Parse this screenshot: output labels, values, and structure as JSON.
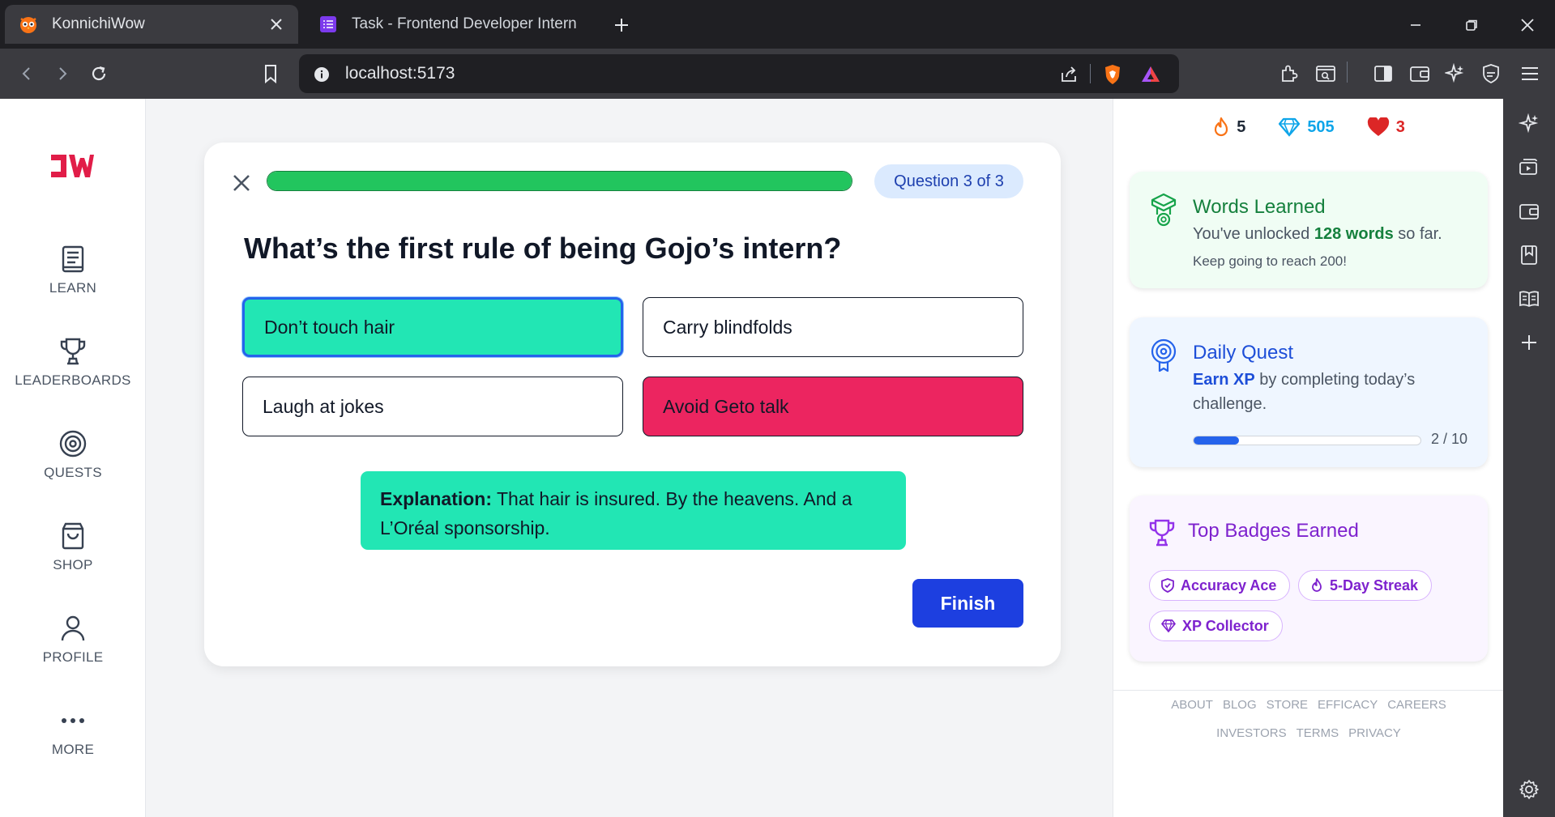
{
  "browser": {
    "tabs": [
      {
        "title": "KonnichiWow",
        "active": true
      },
      {
        "title": "Task - Frontend Developer Intern",
        "active": false
      }
    ],
    "url": "localhost:5173"
  },
  "nav": {
    "logo": "JW",
    "items": [
      {
        "label": "LEARN",
        "icon": "book-icon"
      },
      {
        "label": "LEADERBOARDS",
        "icon": "trophy-icon"
      },
      {
        "label": "QUESTS",
        "icon": "target-icon"
      },
      {
        "label": "SHOP",
        "icon": "shopping-bag-icon"
      },
      {
        "label": "PROFILE",
        "icon": "user-icon"
      },
      {
        "label": "MORE",
        "icon": "more-dots-icon"
      }
    ]
  },
  "quiz": {
    "progress": 1.0,
    "counter": "Question 3 of 3",
    "question": "What’s the first rule of being Gojo’s intern?",
    "options": [
      {
        "label": "Don’t touch hair",
        "state": "selected"
      },
      {
        "label": "Carry blindfolds",
        "state": "default"
      },
      {
        "label": "Laugh at jokes",
        "state": "default"
      },
      {
        "label": "Avoid Geto talk",
        "state": "wrong"
      }
    ],
    "explanation_label": "Explanation:",
    "explanation_text": " That hair is insured. By the heavens. And a L’Oréal sponsorship.",
    "finish_label": "Finish"
  },
  "stats": {
    "streak": "5",
    "gems": "505",
    "hearts": "3"
  },
  "words_card": {
    "title": "Words Learned",
    "text_pre": "You've unlocked ",
    "text_bold": "128 words",
    "text_post": " so far.",
    "sub": "Keep going to reach 200!"
  },
  "quest_card": {
    "title": "Daily Quest",
    "text_bold": "Earn XP",
    "text_post": " by completing today’s challenge.",
    "progress_current": 2,
    "progress_total": 10,
    "progress_label": "2 / 10"
  },
  "badges_card": {
    "title": "Top Badges Earned",
    "badges": [
      {
        "label": "Accuracy Ace",
        "icon": "shield-check-icon"
      },
      {
        "label": "5-Day Streak",
        "icon": "flame-icon"
      },
      {
        "label": "XP Collector",
        "icon": "gem-icon"
      }
    ]
  },
  "footer": {
    "row1": [
      "ABOUT",
      "BLOG",
      "STORE",
      "EFFICACY",
      "CAREERS"
    ],
    "row2": [
      "INVESTORS",
      "TERMS",
      "PRIVACY"
    ]
  },
  "colors": {
    "green_bar": "#22c55e",
    "selected": "#22e6b4",
    "wrong": "#ec2560",
    "primary": "#1d3fe0",
    "logo": "#e11d48"
  }
}
